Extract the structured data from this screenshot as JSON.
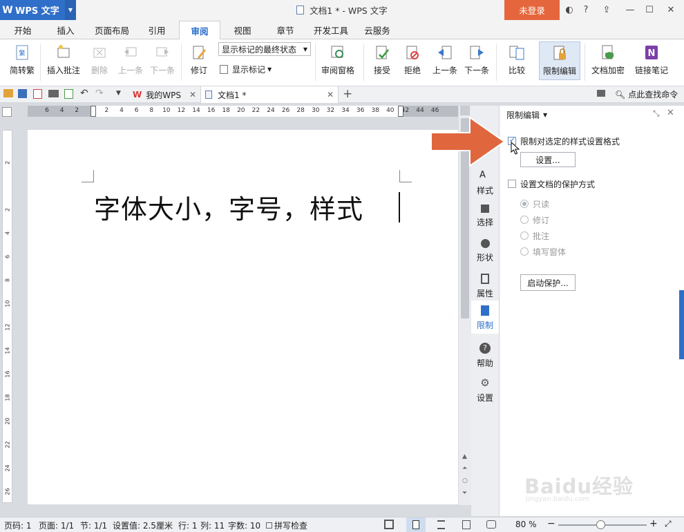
{
  "app": {
    "name": "WPS 文字",
    "logo": "W",
    "doc_title": "文档1 * - WPS 文字",
    "login": "未登录"
  },
  "ribbon_tabs": [
    "开始",
    "插入",
    "页面布局",
    "引用",
    "审阅",
    "视图",
    "章节",
    "开发工具",
    "云服务"
  ],
  "ribbon": {
    "convert": "简转繁",
    "insert_comment": "插入批注",
    "delete": "删除",
    "prev_comment": "上一条",
    "next_comment": "下一条",
    "track": "修订",
    "markup_select": "显示标记的最终状态",
    "show_markup": "显示标记",
    "review_pane": "审阅窗格",
    "accept": "接受",
    "reject": "拒绝",
    "prev_change": "上一条",
    "next_change": "下一条",
    "compare": "比较",
    "restrict": "限制编辑",
    "encrypt": "文档加密",
    "link_notes": "链接笔记"
  },
  "tabs": {
    "mywps": "我的WPS",
    "doc1": "文档1 *",
    "search": "点此查找命令"
  },
  "ruler_ticks": [
    "6",
    "4",
    "2",
    "",
    "2",
    "4",
    "6",
    "8",
    "10",
    "12",
    "14",
    "16",
    "18",
    "20",
    "22",
    "24",
    "26",
    "28",
    "30",
    "32",
    "34",
    "36",
    "38",
    "40",
    "42",
    "44",
    "46"
  ],
  "vruler_ticks": [
    "2",
    "",
    "2",
    "4",
    "6",
    "8",
    "10",
    "12",
    "14",
    "16",
    "18",
    "20",
    "22",
    "24",
    "26"
  ],
  "document": {
    "text": "字体大小，字号，样式"
  },
  "side_tools": [
    "样式",
    "选择",
    "形状",
    "属性",
    "限制",
    "帮助",
    "设置"
  ],
  "panel": {
    "title": "限制编辑",
    "opt_format": "限制对选定的样式设置格式",
    "settings_btn": "设置...",
    "opt_protect": "设置文档的保护方式",
    "modes": [
      "只读",
      "修订",
      "批注",
      "填写窗体"
    ],
    "start_btn": "启动保护..."
  },
  "status": {
    "page": "页码: 1",
    "pages": "页面: 1/1",
    "section": "节: 1/1",
    "setting": "设置值: 2.5厘米",
    "line": "行: 1",
    "col": "列: 11",
    "words": "字数: 10",
    "spell": "拼写检查",
    "zoom": "80 %"
  },
  "watermark": {
    "brand": "Baidu经验",
    "url": "jingyan.baidu.com"
  },
  "colors": {
    "accent": "#2f6fc9",
    "login": "#e5663c",
    "arrow": "#e0663e"
  }
}
